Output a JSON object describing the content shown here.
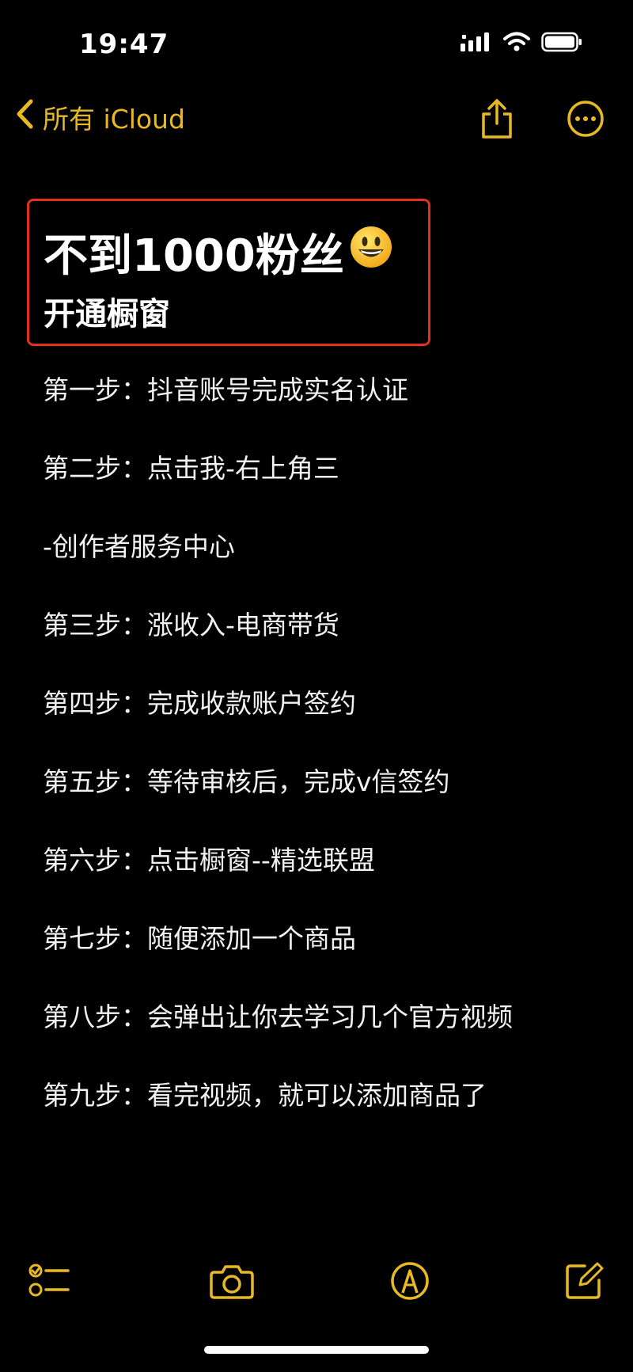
{
  "status_bar": {
    "time": "19:47",
    "icons": [
      "cellular-signal-icon",
      "wifi-icon",
      "battery-icon"
    ]
  },
  "nav": {
    "back_label": "所有 iCloud",
    "back_icon": "chevron-left-icon",
    "share_icon": "share-icon",
    "more_icon": "ellipsis-circle-icon",
    "accent_color": "#E8B923"
  },
  "note": {
    "title": "不到1000粉丝",
    "title_emoji": "smiley-face-emoji",
    "subtitle": "开通橱窗",
    "highlight_color": "#E0301E",
    "steps": [
      "第一步：抖音账号完成实名认证",
      "第二步：点击我-右上角三",
      "-创作者服务中心",
      "第三步：涨收入-电商带货",
      "第四步：完成收款账户签约",
      "第五步：等待审核后，完成v信签约",
      "第六步：点击橱窗--精选联盟",
      "第七步：随便添加一个商品",
      "第八步：会弹出让你去学习几个官方视频",
      "第九步：看完视频，就可以添加商品了"
    ]
  },
  "toolbar": {
    "icons": [
      "checklist-icon",
      "camera-icon",
      "markup-pen-icon",
      "compose-icon"
    ]
  }
}
